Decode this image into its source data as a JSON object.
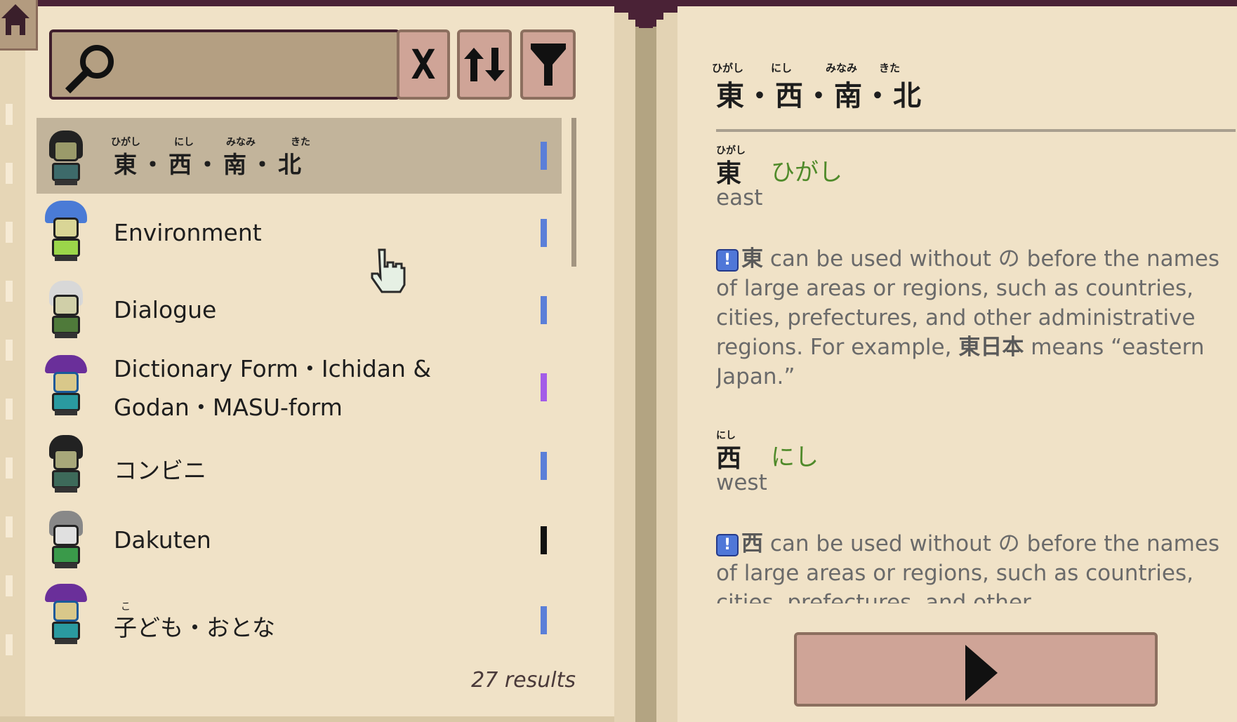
{
  "search": {
    "placeholder": "",
    "value": ""
  },
  "buttons": {
    "clear_label": "X",
    "sort_label": "↑↓"
  },
  "list": {
    "items": [
      {
        "label": "東・西・南・北",
        "furigana": [
          "ひがし",
          "にし",
          "みなみ",
          "きた"
        ],
        "marker_color": "#5b7fd8",
        "selected": true
      },
      {
        "label": "Environment",
        "marker_color": "#5b7fd8"
      },
      {
        "label": "Dialogue",
        "marker_color": "#5b7fd8"
      },
      {
        "label": "Dictionary Form・Ichidan & Godan・MASU-form",
        "marker_color": "#a35ce8"
      },
      {
        "label": "コンビニ",
        "marker_color": "#5b7fd8"
      },
      {
        "label": "Dakuten",
        "marker_color": "#111111"
      },
      {
        "label": "子ども・おとな",
        "furigana": [
          "こ"
        ],
        "marker_color": "#5b7fd8"
      }
    ],
    "results_text": "27 results"
  },
  "detail": {
    "title": "東・西・南・北",
    "title_furigana": [
      "ひがし",
      "にし",
      "みなみ",
      "きた"
    ],
    "entries": [
      {
        "kanji": "東",
        "furigana": "ひがし",
        "reading": "ひがし",
        "meaning": "east",
        "note_kanji": "東",
        "note_text": " can be used without の before the names of large areas or regions, such as countries, cities, prefectures, and other administrative regions. For example, ",
        "note_example": "東日本",
        "note_tail": " means “eastern Japan.”"
      },
      {
        "kanji": "西",
        "furigana": "にし",
        "reading": "にし",
        "meaning": "west",
        "note_kanji": "西",
        "note_text": " can be used without の before the names of large areas or regions, such as countries, cities, prefectures, and other"
      }
    ]
  }
}
